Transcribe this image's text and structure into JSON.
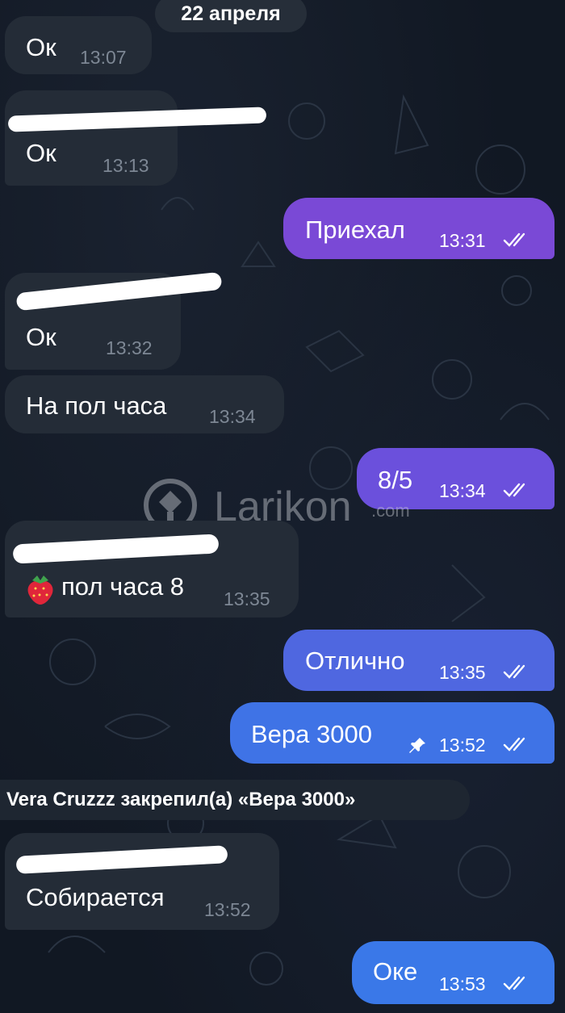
{
  "chat": {
    "date_separator": "22 апреля",
    "service_message": "Vera Cruzzz закрепил(а) «Вера 3000»",
    "watermark": {
      "brand": "Larikon",
      "suffix": ".com"
    },
    "messages": [
      {
        "direction": "incoming",
        "text": "Ок",
        "time": "13:07"
      },
      {
        "direction": "incoming",
        "sender_redacted": true,
        "text": "Ок",
        "time": "13:13"
      },
      {
        "direction": "outgoing",
        "text": "Приехал",
        "time": "13:31",
        "status": "read",
        "color": "#7a49d6"
      },
      {
        "direction": "incoming",
        "sender_redacted": true,
        "text": "Ок",
        "time": "13:32"
      },
      {
        "direction": "incoming",
        "text": "На пол часа",
        "time": "13:34"
      },
      {
        "direction": "outgoing",
        "text": "8/5",
        "time": "13:34",
        "status": "read",
        "color": "#6b50dc"
      },
      {
        "direction": "incoming",
        "sender_redacted": true,
        "emoji": "strawberry-icon",
        "text": "пол часа 8",
        "time": "13:35"
      },
      {
        "direction": "outgoing",
        "text": "Отлично",
        "time": "13:35",
        "status": "read",
        "color": "#4f67e0"
      },
      {
        "direction": "outgoing",
        "text": "Вера 3000",
        "time": "13:52",
        "status": "read",
        "pinned": true,
        "color": "#3f73e6"
      },
      {
        "direction": "incoming",
        "sender_redacted": true,
        "text": "Собирается",
        "time": "13:52"
      },
      {
        "direction": "outgoing",
        "text": "Оке",
        "time": "13:53",
        "status": "read",
        "color": "#3a78e8"
      }
    ]
  },
  "colors": {
    "incoming_bubble": "#242c37",
    "background": "#111823",
    "sender_name": "#d9a24a"
  }
}
